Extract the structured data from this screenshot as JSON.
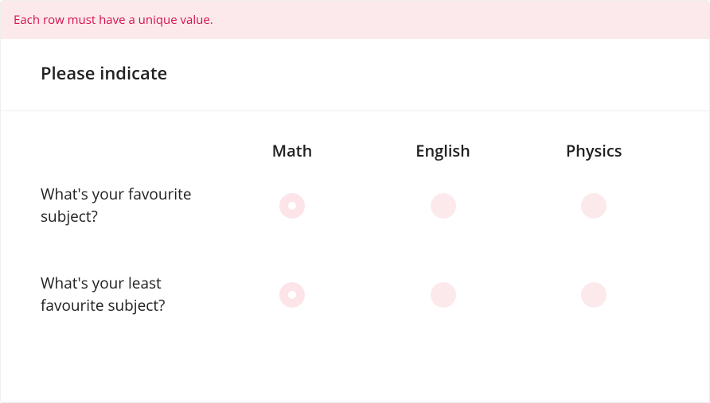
{
  "error": {
    "message": "Each row must have a unique value."
  },
  "question": {
    "title": "Please indicate"
  },
  "matrix": {
    "columns": [
      "Math",
      "English",
      "Physics"
    ],
    "rows": [
      {
        "label": "What's your favourite subject?",
        "selected": 0
      },
      {
        "label": "What's your least favourite subject?",
        "selected": 0
      }
    ]
  }
}
